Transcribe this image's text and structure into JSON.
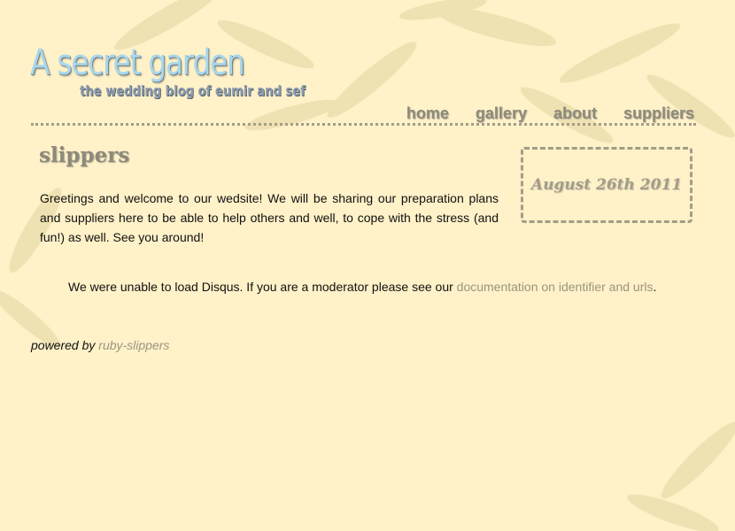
{
  "header": {
    "title": "A secret garden",
    "tagline": "the wedding blog of eumir and sef"
  },
  "nav": {
    "items": [
      {
        "label": "home"
      },
      {
        "label": "gallery"
      },
      {
        "label": "about"
      },
      {
        "label": "suppliers"
      }
    ]
  },
  "post": {
    "title": "slippers",
    "date": "August 26th 2011",
    "body": "Greetings and welcome to our wedsite! We will be sharing our preparation plans and suppliers here to be able to help others and well, to cope with the stress (and fun!) as well. See you around!"
  },
  "comments": {
    "message_prefix": "We were unable to load Disqus. If you are a moderator please see our ",
    "link_text": "documentation on identifier and urls",
    "message_suffix": "."
  },
  "footer": {
    "prefix": "powered by ",
    "link_text": "ruby-slippers"
  },
  "colors": {
    "background": "#fff1c8",
    "title_blue": "#a9d6ea",
    "accent_taupe": "#a39d88",
    "link": "#9a9580"
  }
}
